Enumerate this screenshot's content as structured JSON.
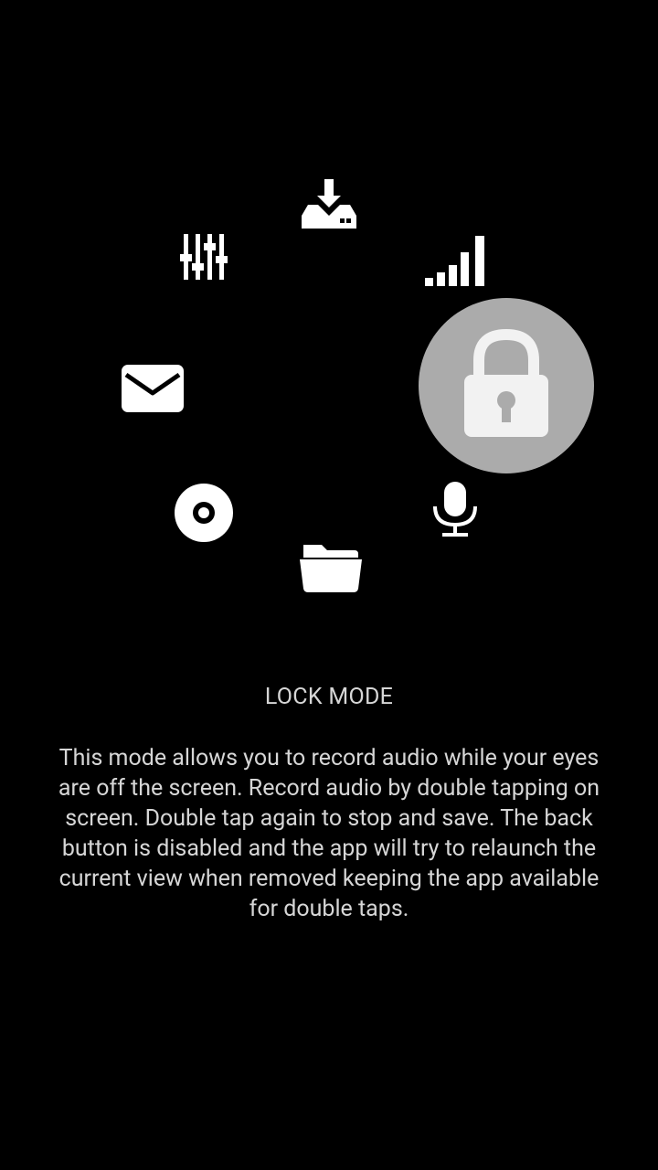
{
  "mode_selector": {
    "selected_mode": "lock",
    "selected_highlight_color": "#ababab",
    "icon_color": "#ffffff",
    "icons": [
      {
        "id": "download",
        "icon": "download-icon"
      },
      {
        "id": "signal",
        "icon": "signal-bars-icon"
      },
      {
        "id": "lock",
        "icon": "lock-icon"
      },
      {
        "id": "mic",
        "icon": "microphone-icon"
      },
      {
        "id": "folder",
        "icon": "folder-icon"
      },
      {
        "id": "disc",
        "icon": "disc-icon"
      },
      {
        "id": "mail",
        "icon": "mail-icon"
      },
      {
        "id": "mixer",
        "icon": "equalizer-sliders-icon"
      }
    ]
  },
  "mode_info": {
    "title": "LOCK MODE",
    "description": "This mode allows you to record audio while your eyes are off the screen. Record audio by double tapping on screen. Double tap again to stop and save. The back button is disabled and the app will try to relaunch the current view when removed keeping the app available for double taps."
  }
}
